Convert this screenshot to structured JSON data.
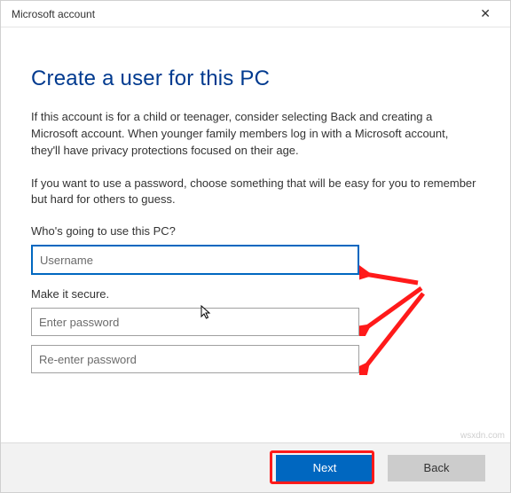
{
  "window": {
    "title": "Microsoft account",
    "close_glyph": "✕"
  },
  "heading": "Create a user for this PC",
  "paragraph1": "If this account is for a child or teenager, consider selecting Back and creating a Microsoft account. When younger family members log in with a Microsoft account, they'll have privacy protections focused on their age.",
  "paragraph2": "If you want to use a password, choose something that will be easy for you to remember but hard for others to guess.",
  "section1_label": "Who's going to use this PC?",
  "username_placeholder": "Username",
  "section2_label": "Make it secure.",
  "password_placeholder": "Enter password",
  "reenter_placeholder": "Re-enter password",
  "footer": {
    "next_label": "Next",
    "back_label": "Back"
  },
  "watermark": "wsxdn.com",
  "colors": {
    "accent": "#0067c0",
    "heading": "#003a8f",
    "arrow": "#ff1a1a"
  }
}
